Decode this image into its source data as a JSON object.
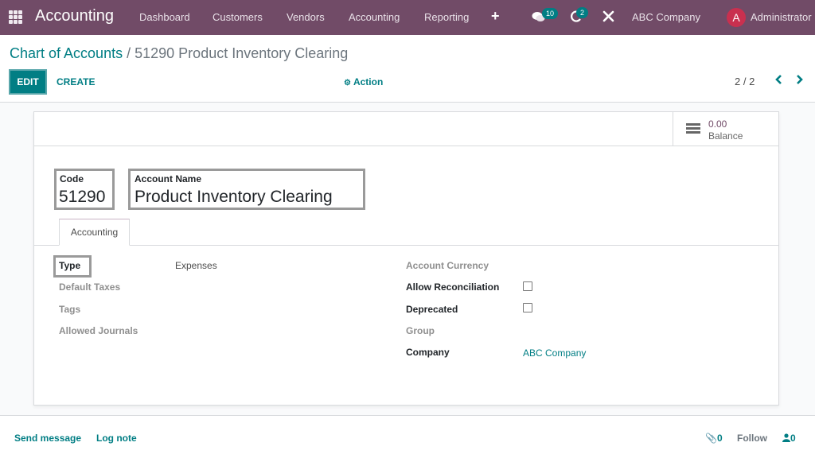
{
  "navbar": {
    "app_title": "Accounting",
    "menus": [
      "Dashboard",
      "Customers",
      "Vendors",
      "Accounting",
      "Reporting"
    ],
    "messages_badge": "10",
    "activities_badge": "2",
    "company": "ABC Company",
    "avatar_initial": "A",
    "user_name": "Administrator"
  },
  "breadcrumb": {
    "parent": "Chart of Accounts",
    "separator": "/",
    "current": "51290 Product Inventory Clearing"
  },
  "toolbar": {
    "edit_label": "EDIT",
    "create_label": "CREATE",
    "action_label": "Action"
  },
  "pager": {
    "value": "2 / 2"
  },
  "stat_button": {
    "value": "0.00",
    "label": "Balance"
  },
  "record": {
    "code_label": "Code",
    "code": "51290",
    "name_label": "Account Name",
    "name": "Product Inventory Clearing"
  },
  "tabs": [
    {
      "label": "Accounting",
      "active": true
    }
  ],
  "fields_left": [
    {
      "label": "Type",
      "value": "Expenses",
      "highlighted": true
    },
    {
      "label": "Default Taxes",
      "value": ""
    },
    {
      "label": "Tags",
      "value": ""
    },
    {
      "label": "Allowed Journals",
      "value": ""
    }
  ],
  "fields_right": [
    {
      "label": "Account Currency",
      "value": ""
    },
    {
      "label": "Allow Reconciliation",
      "checked": false
    },
    {
      "label": "Deprecated",
      "checked": false
    },
    {
      "label": "Group",
      "value": ""
    },
    {
      "label": "Company",
      "value": "ABC Company"
    }
  ],
  "chatter": {
    "send_message": "Send message",
    "log_note": "Log note",
    "attachments_count": "0",
    "follow_label": "Follow",
    "followers_count": "0"
  },
  "colors": {
    "brand": "#714b67",
    "accent": "#017e84",
    "avatar": "#c9304f"
  }
}
